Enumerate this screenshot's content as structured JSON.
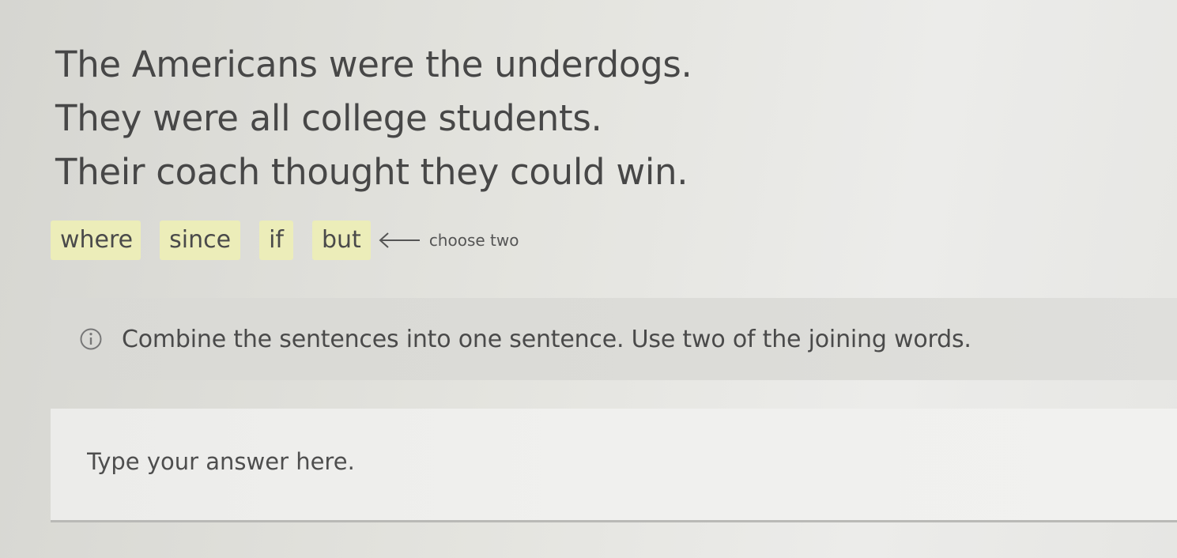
{
  "sentences": [
    "The Americans were the underdogs.",
    "They were all college students.",
    "Their coach thought they could win."
  ],
  "word_bank": {
    "words": [
      "where",
      "since",
      "if",
      "but"
    ],
    "hint": "choose two",
    "chip_color": "#ecedb9"
  },
  "instruction": {
    "icon": "info-icon",
    "text": "Combine the sentences into one sentence. Use two of the joining words."
  },
  "answer": {
    "value": "",
    "placeholder": "Type your answer here."
  }
}
